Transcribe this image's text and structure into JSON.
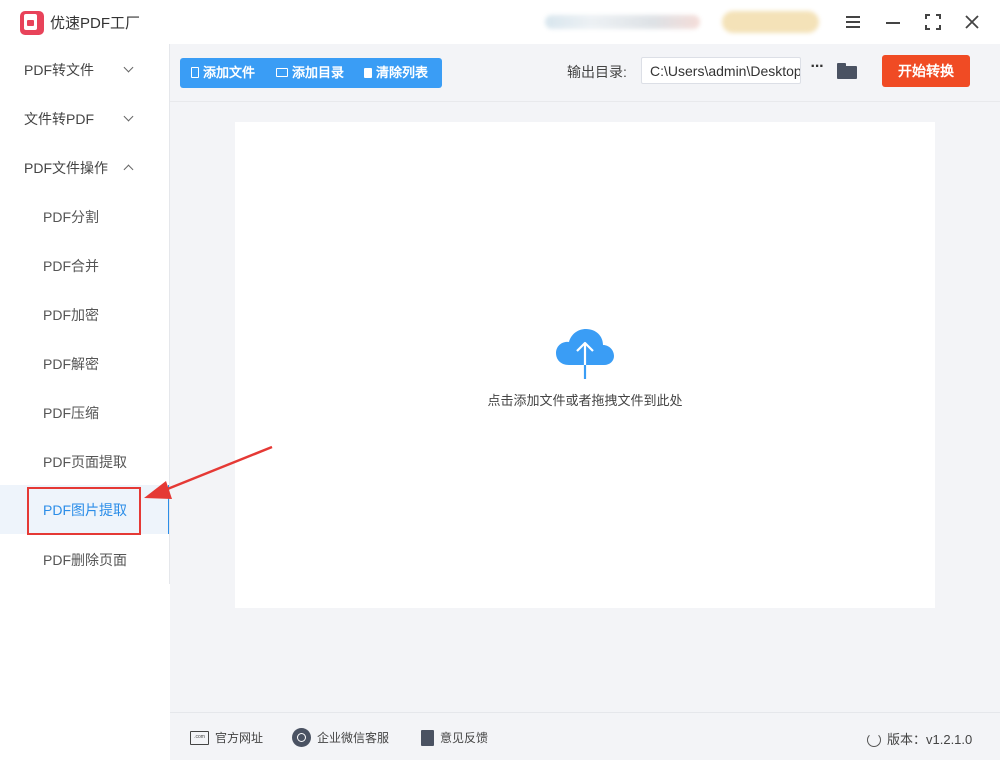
{
  "app": {
    "title": "优速PDF工厂"
  },
  "window_controls": [
    "menu-icon",
    "minimize-icon",
    "maximize-icon",
    "close-icon"
  ],
  "sidebar": {
    "groups": [
      {
        "label": "PDF转文件",
        "expanded": false
      },
      {
        "label": "文件转PDF",
        "expanded": false
      },
      {
        "label": "PDF文件操作",
        "expanded": true
      }
    ],
    "subitems": [
      {
        "label": "PDF分割"
      },
      {
        "label": "PDF合并"
      },
      {
        "label": "PDF加密"
      },
      {
        "label": "PDF解密"
      },
      {
        "label": "PDF压缩"
      },
      {
        "label": "PDF页面提取"
      },
      {
        "label": "PDF图片提取",
        "active": true
      },
      {
        "label": "PDF删除页面"
      }
    ]
  },
  "toolbar": {
    "add_file": "添加文件",
    "add_folder": "添加目录",
    "clear_list": "清除列表",
    "output_label": "输出目录:",
    "output_path": "C:\\Users\\admin\\Desktop",
    "start": "开始转换"
  },
  "dropzone": {
    "hint": "点击添加文件或者拖拽文件到此处"
  },
  "footer": {
    "website": "官方网址",
    "wechat": "企业微信客服",
    "feedback": "意见反馈",
    "version": "版本：v1.2.1.0"
  },
  "colors": {
    "accent_blue": "#3a9df5",
    "start_orange": "#f04b24",
    "annotation_red": "#e53935",
    "logo_pink": "#e8435a"
  }
}
